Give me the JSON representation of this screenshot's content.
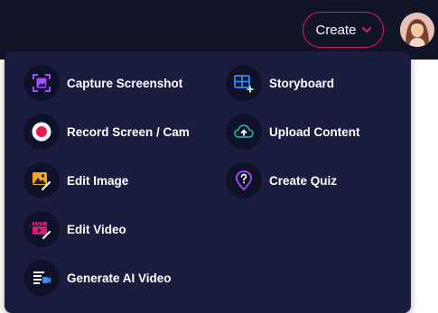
{
  "header": {
    "create_label": "Create",
    "user_avatar": "avatar-icon"
  },
  "menu": {
    "left": [
      {
        "label": "Capture Screenshot",
        "icon": "capture-screenshot-icon"
      },
      {
        "label": "Record Screen / Cam",
        "icon": "record-icon"
      },
      {
        "label": "Edit Image",
        "icon": "edit-image-icon"
      },
      {
        "label": "Edit Video",
        "icon": "edit-video-icon"
      },
      {
        "label": "Generate AI Video",
        "icon": "ai-video-icon"
      }
    ],
    "right": [
      {
        "label": "Storyboard",
        "icon": "storyboard-icon"
      },
      {
        "label": "Upload Content",
        "icon": "upload-cloud-icon"
      },
      {
        "label": "Create Quiz",
        "icon": "quiz-icon"
      }
    ]
  },
  "colors": {
    "topbar_bg": "#121428",
    "panel_bg": "#1b1d40",
    "accent_pink": "#d81b72",
    "accent_purple": "#a64dff",
    "accent_blue": "#2f8cff",
    "accent_teal": "#1fa9a0",
    "accent_orange": "#f4a51c"
  }
}
